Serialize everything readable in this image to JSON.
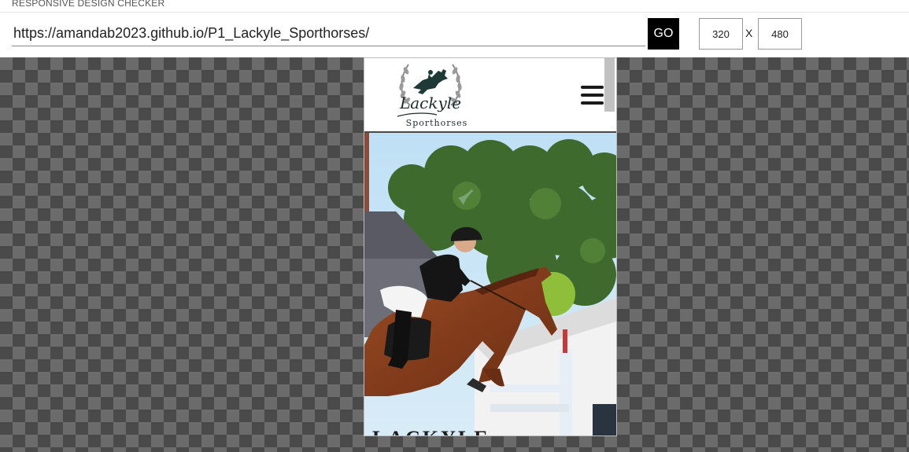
{
  "app": {
    "title": "RESPONSIVE DESIGN CHECKER"
  },
  "toolbar": {
    "url": "https://amandab2023.github.io/P1_Lackyle_Sporthorses/",
    "go_label": "GO",
    "width": "320",
    "separator": "X",
    "height": "480"
  },
  "preview": {
    "logo": {
      "script_text": "Lackyle",
      "subtitle": "Sporthorses"
    },
    "hero": {
      "heading": "LACKYLE"
    }
  },
  "colors": {
    "go_button": "#000000",
    "checker_dark": "#4a4a4a",
    "checker_light": "#6b6b6b"
  }
}
